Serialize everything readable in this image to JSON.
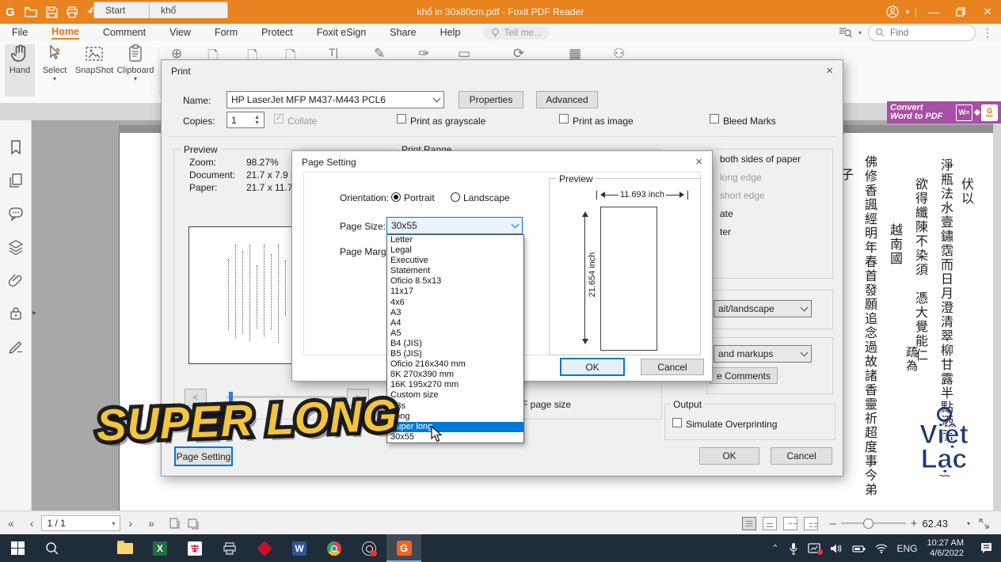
{
  "titlebar": {
    "title": "khổ in 30x80cm.pdf - Foxit PDF Reader",
    "undo_glyph": "↶",
    "redo_glyph": "↷",
    "minimize_glyph": "—",
    "close_glyph": "×",
    "hand_caret": "▾",
    "customize_caret": "▾",
    "account_caret": "▾",
    "separator": "|",
    "logo_letter": "G"
  },
  "menubar": {
    "items": [
      {
        "label": "File"
      },
      {
        "label": "Home",
        "cls": "active"
      },
      {
        "label": "Comment"
      },
      {
        "label": "View"
      },
      {
        "label": "Form"
      },
      {
        "label": "Protect"
      },
      {
        "label": "Foxit eSign"
      },
      {
        "label": "Share"
      },
      {
        "label": "Help"
      }
    ],
    "tellme": "Tell me...",
    "find_placeholder": "Find",
    "dots_glyph": "⋮",
    "search_caret": "▾"
  },
  "ribbon": {
    "tools": [
      {
        "label": "Hand"
      },
      {
        "label": "Select",
        "caret": "▾"
      },
      {
        "label": "SnapShot"
      },
      {
        "label": "Clipboard",
        "caret": "▾"
      }
    ],
    "peek_glyphs": [
      "⊕",
      "🗋",
      "🗋",
      "🗋",
      "T|",
      "✎",
      "✑",
      "▭",
      "⟳",
      "▦",
      "⚇"
    ]
  },
  "tabs": {
    "start": "Start",
    "document": "khổ"
  },
  "convert_banner": {
    "line1": "Convert",
    "line2": "Word to PDF",
    "w_label": "W≡",
    "g_label": "G",
    "g_sub": "PDF"
  },
  "print_dialog": {
    "title": "Print",
    "close_glyph": "×",
    "name_label": "Name:",
    "printer_name": "HP LaserJet MFP M437-M443 PCL6",
    "properties_btn": "Properties",
    "advanced_btn": "Advanced",
    "copies_label": "Copies:",
    "copies_value": "1",
    "collate_label": "Collate",
    "grayscale_label": "Print as grayscale",
    "as_image_label": "Print as image",
    "bleed_label": "Bleed Marks",
    "preview_label": "Preview",
    "zoom_label": "Zoom:",
    "zoom_value": "98.27%",
    "document_label": "Document:",
    "document_value": "21.7 x 7.9 in",
    "paper_label": "Paper:",
    "paper_value": "21.7 x 11.7 in",
    "print_range_label": "Print Range",
    "prev_btn_glyph": "<",
    "next_btn_glyph": ">",
    "page_setting_btn": "Page Setting",
    "right_fragments": {
      "both_sides": "both sides of paper",
      "long_edge": "long edge",
      "short_edge": "short edge",
      "ate": "ate",
      "ter": "ter",
      "landscape_dd": "ait/landscape",
      "markups_dd": "and markups",
      "comments_btn": "e Comments",
      "page_size_fragment": "F page size"
    },
    "output_label": "Output",
    "simulate_label": "Simulate Overprinting",
    "ok_btn": "OK",
    "cancel_btn": "Cancel"
  },
  "page_setting_dialog": {
    "title": "Page Setting",
    "close_glyph": "×",
    "orientation_label": "Orientation:",
    "portrait_label": "Portrait",
    "landscape_label": "Landscape",
    "page_size_label": "Page Size:",
    "page_size_value": "30x55",
    "page_margins_label": "Page Margins:",
    "options": [
      {
        "label": "Letter"
      },
      {
        "label": "Legal"
      },
      {
        "label": "Executive"
      },
      {
        "label": "Statement"
      },
      {
        "label": "Oficio 8.5x13"
      },
      {
        "label": "11x17"
      },
      {
        "label": "4x6"
      },
      {
        "label": "A3"
      },
      {
        "label": "A4"
      },
      {
        "label": "A5"
      },
      {
        "label": "B4 (JIS)"
      },
      {
        "label": "B5 (JIS)"
      },
      {
        "label": "Oficio 216x340 mm"
      },
      {
        "label": "8K 270x390 mm"
      },
      {
        "label": "16K 195x270 mm"
      },
      {
        "label": "Custom size"
      },
      {
        "label": "A3s"
      },
      {
        "label": "Long"
      },
      {
        "label": "Super long",
        "cls": "selected"
      },
      {
        "label": "30x55"
      }
    ],
    "preview_label": "Preview",
    "width_dim": "11.693 inch",
    "height_dim": "21.654 inch",
    "ok_btn": "OK",
    "cancel_btn": "Cancel"
  },
  "overlay": {
    "caption": "SUPER LONG"
  },
  "document": {
    "columns": [
      {
        "text": "子",
        "cls": "c1"
      },
      {
        "text": "佛修香諷經明年春首發願追念過故諸香靈祈超度事今弟",
        "cls": "c2"
      },
      {
        "text": "越南國",
        "cls": "c3"
      },
      {
        "text": "疏為",
        "cls": "c4"
      },
      {
        "text": "欲得纖陳不染須　憑大覺能仁",
        "cls": "c5"
      },
      {
        "text": "淨瓶法水壹鏽霑而日月澄清翠柳甘露半點洒而",
        "cls": "c6"
      },
      {
        "text": "伏以",
        "cls": "c7"
      }
    ],
    "watermark_line1": "Việt",
    "watermark_line2": "Lạc"
  },
  "statusbar": {
    "first_glyph": "«",
    "prev_glyph": "‹",
    "next_glyph": "›",
    "last_glyph": "»",
    "page_value": "1 / 1",
    "page_caret": "▾",
    "minus_glyph": "–",
    "plus_glyph": "+",
    "zoom_value": "62.43",
    "zoom_caret": "▾"
  },
  "taskbar": {
    "lang": "ENG",
    "time": "10:27 AM",
    "date": "4/6/2022",
    "excel_letter": "X",
    "word_letter": "W",
    "foxit_letter": "G",
    "chevron": "⌃"
  }
}
